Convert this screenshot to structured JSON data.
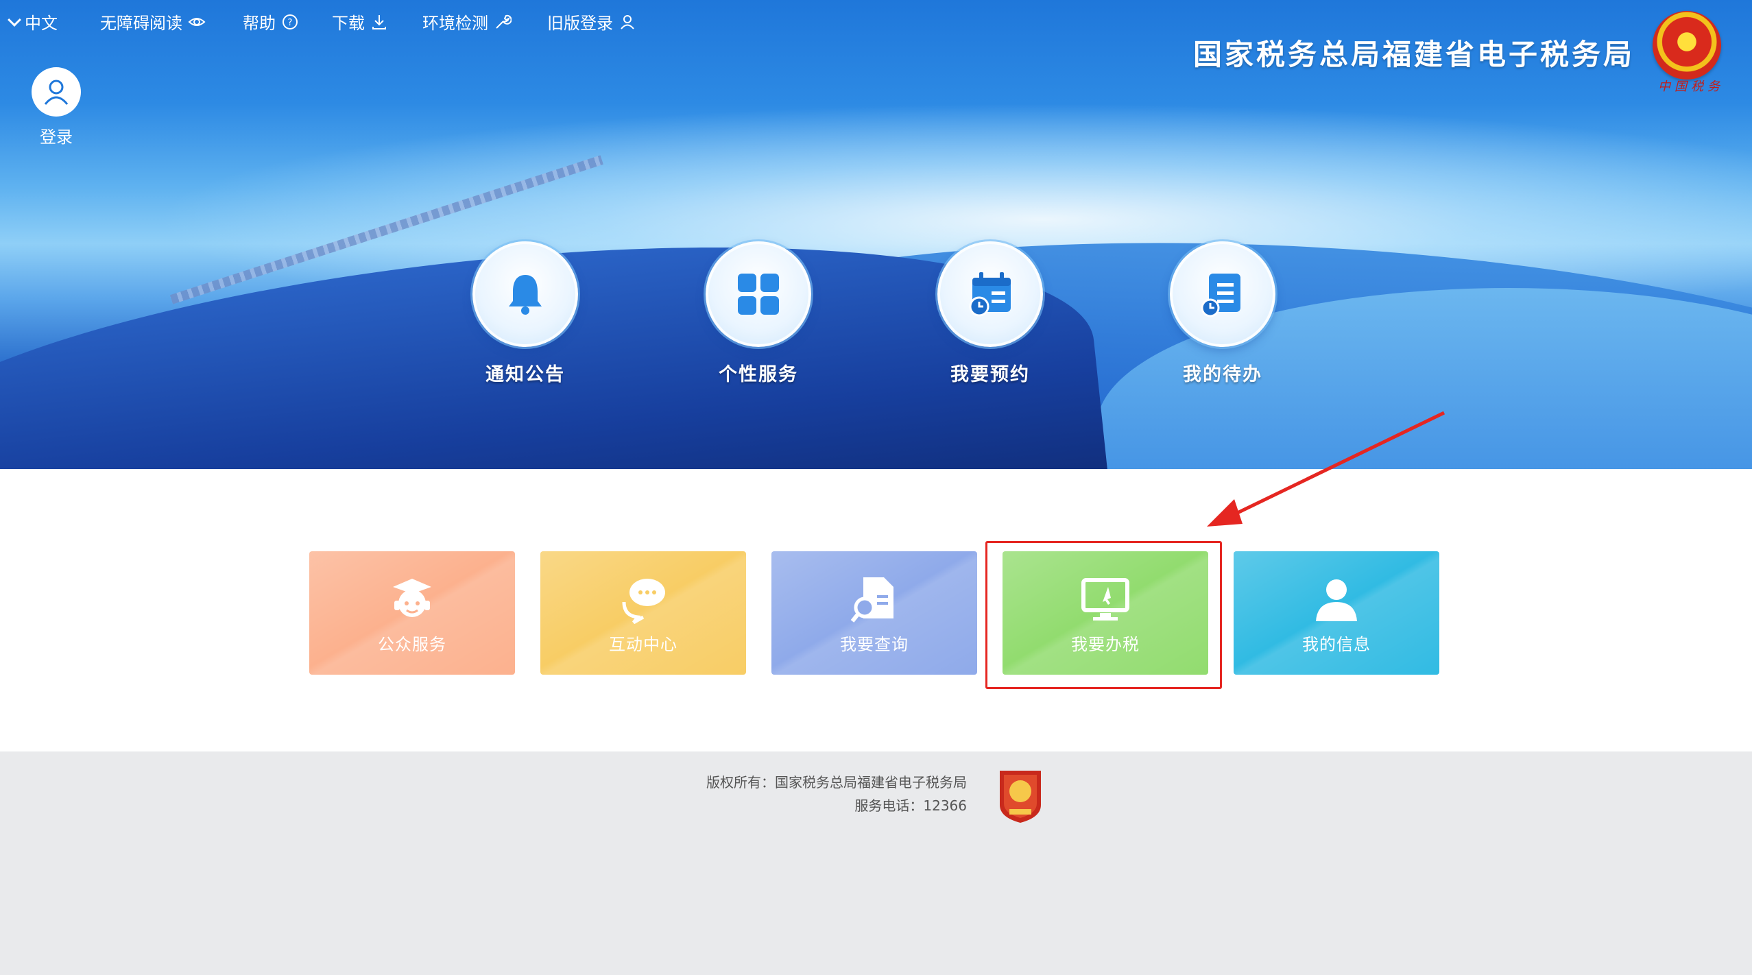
{
  "topbar": {
    "language": "中文",
    "accessibility": "无障碍阅读",
    "help": "帮助",
    "download": "下载",
    "env_check": "环境检测",
    "old_login": "旧版登录"
  },
  "login": {
    "label": "登录"
  },
  "header": {
    "title": "国家税务总局福建省电子税务局",
    "emblem_caption": "中国税务"
  },
  "circle_menu": [
    {
      "label": "通知公告",
      "icon": "bell-icon"
    },
    {
      "label": "个性服务",
      "icon": "grid-icon"
    },
    {
      "label": "我要预约",
      "icon": "calendar-clock-icon"
    },
    {
      "label": "我的待办",
      "icon": "todo-list-icon"
    }
  ],
  "tiles": [
    {
      "label": "公众服务",
      "color": "#fcb18e",
      "icon": "service-person-icon"
    },
    {
      "label": "互动中心",
      "color": "#f8cd65",
      "icon": "chat-bubbles-icon"
    },
    {
      "label": "我要查询",
      "color": "#8faaea",
      "icon": "document-search-icon"
    },
    {
      "label": "我要办税",
      "color": "#92dc6f",
      "icon": "monitor-cursor-icon"
    },
    {
      "label": "我的信息",
      "color": "#31bbe3",
      "icon": "user-icon"
    }
  ],
  "footer": {
    "copyright": "版权所有：国家税务总局福建省电子税务局",
    "hotline": "服务电话：12366"
  },
  "colors": {
    "highlight": "#e52621",
    "banner_blue": "#1f77da"
  }
}
